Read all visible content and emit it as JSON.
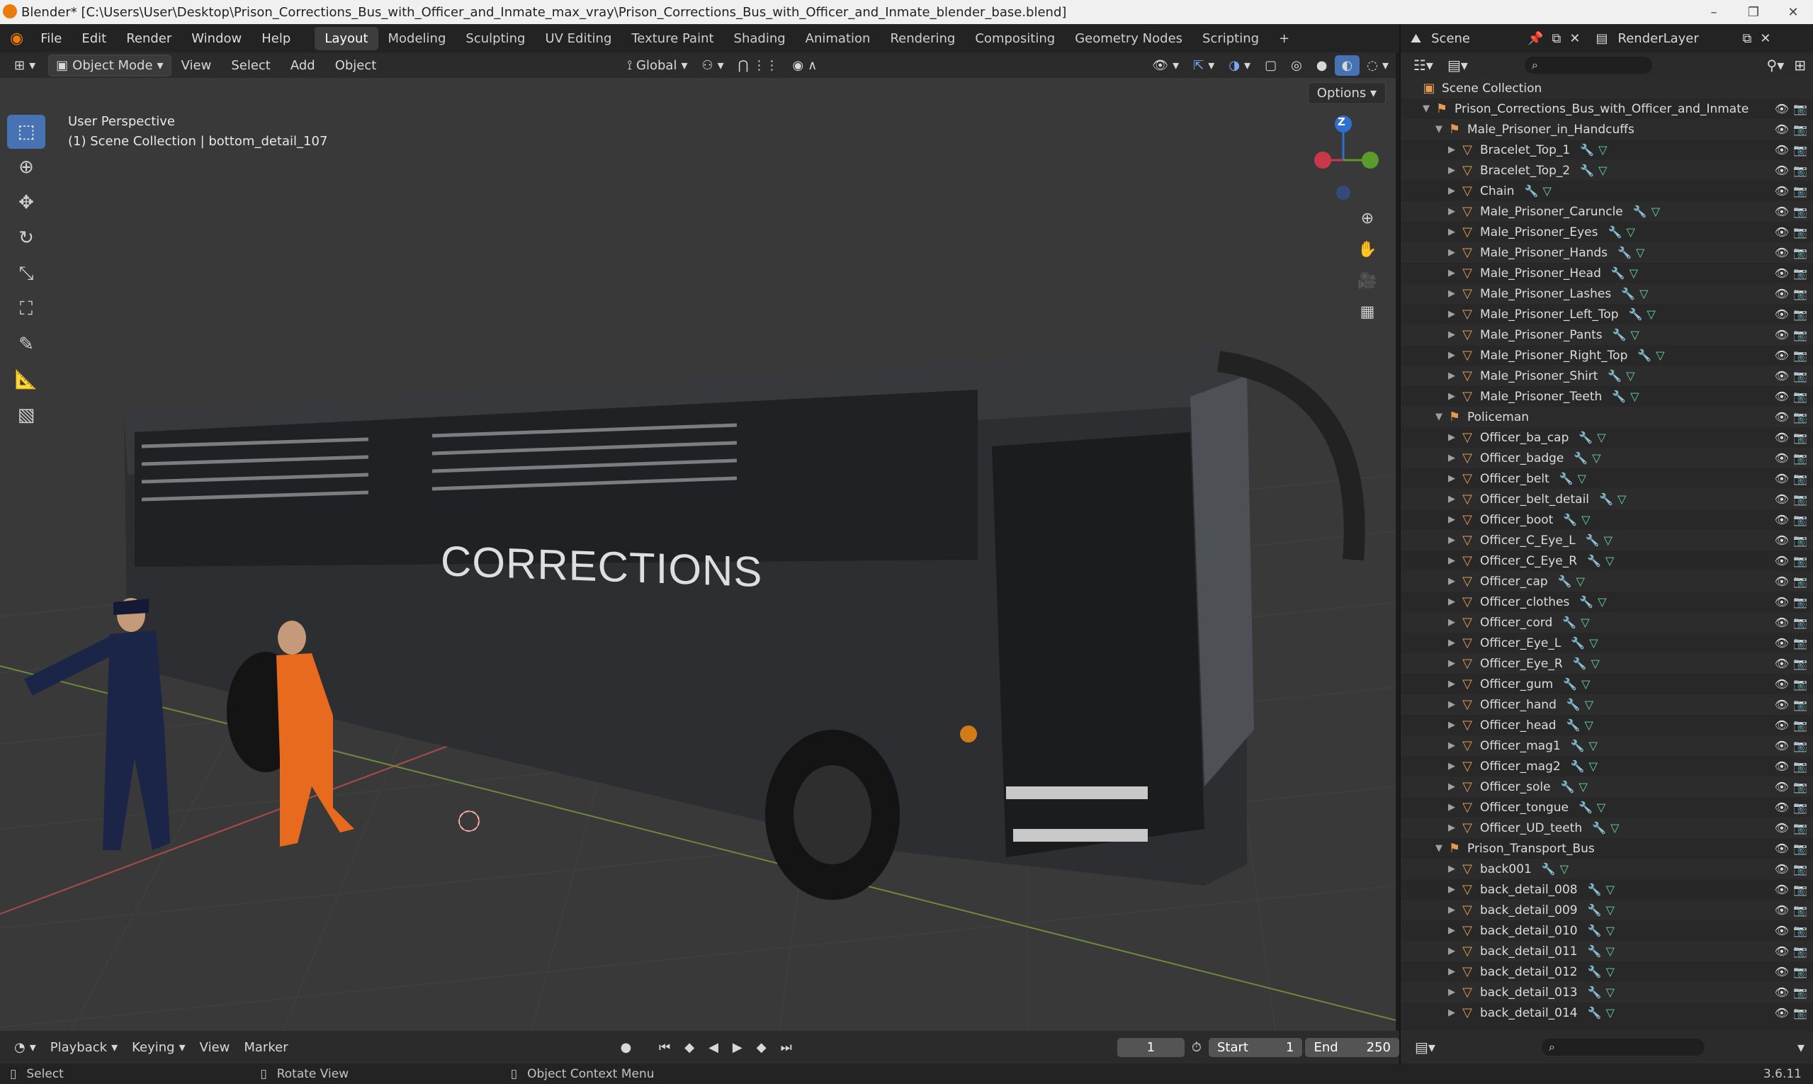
{
  "window": {
    "title": "Blender* [C:\\Users\\User\\Desktop\\Prison_Corrections_Bus_with_Officer_and_Inmate_max_vray\\Prison_Corrections_Bus_with_Officer_and_Inmate_blender_base.blend]",
    "buttons": [
      "–",
      "❐",
      "✕"
    ]
  },
  "menu": [
    "File",
    "Edit",
    "Render",
    "Window",
    "Help"
  ],
  "workspaces": [
    "Layout",
    "Modeling",
    "Sculpting",
    "UV Editing",
    "Texture Paint",
    "Shading",
    "Animation",
    "Rendering",
    "Compositing",
    "Geometry Nodes",
    "Scripting"
  ],
  "active_workspace": "Layout",
  "add_workspace": "+",
  "scene_field": "Scene",
  "render_layer_field": "RenderLayer",
  "viewport_header": {
    "mode": "Object Mode",
    "menus": [
      "View",
      "Select",
      "Add",
      "Object"
    ],
    "orientation": "Global",
    "options": "Options"
  },
  "viewport": {
    "perspective": "User Perspective",
    "collection_info": "(1) Scene Collection | bottom_detail_107",
    "bus_text": "CORRECTIONS",
    "gizmo_axis": "Z"
  },
  "timeline": {
    "menus": [
      "Playback",
      "Keying",
      "View",
      "Marker"
    ],
    "current_frame": "1",
    "start_label": "Start",
    "start": "1",
    "end_label": "End",
    "end": "250"
  },
  "status": {
    "select": "Select",
    "rotate": "Rotate View",
    "context": "Object Context Menu",
    "version": "3.6.11"
  },
  "outliner": [
    {
      "name": "Scene Collection",
      "level": 0,
      "kind": "scene"
    },
    {
      "name": "Prison_Corrections_Bus_with_Officer_and_Inmate",
      "level": 1,
      "kind": "collection"
    },
    {
      "name": "Male_Prisoner_in_Handcuffs",
      "level": 2,
      "kind": "collection"
    },
    {
      "name": "Bracelet_Top_1",
      "level": 3,
      "kind": "object"
    },
    {
      "name": "Bracelet_Top_2",
      "level": 3,
      "kind": "object"
    },
    {
      "name": "Chain",
      "level": 3,
      "kind": "object"
    },
    {
      "name": "Male_Prisoner_Caruncle",
      "level": 3,
      "kind": "object"
    },
    {
      "name": "Male_Prisoner_Eyes",
      "level": 3,
      "kind": "object"
    },
    {
      "name": "Male_Prisoner_Hands",
      "level": 3,
      "kind": "object"
    },
    {
      "name": "Male_Prisoner_Head",
      "level": 3,
      "kind": "object"
    },
    {
      "name": "Male_Prisoner_Lashes",
      "level": 3,
      "kind": "object"
    },
    {
      "name": "Male_Prisoner_Left_Top",
      "level": 3,
      "kind": "object"
    },
    {
      "name": "Male_Prisoner_Pants",
      "level": 3,
      "kind": "object"
    },
    {
      "name": "Male_Prisoner_Right_Top",
      "level": 3,
      "kind": "object"
    },
    {
      "name": "Male_Prisoner_Shirt",
      "level": 3,
      "kind": "object"
    },
    {
      "name": "Male_Prisoner_Teeth",
      "level": 3,
      "kind": "object"
    },
    {
      "name": "Policeman",
      "level": 2,
      "kind": "collection"
    },
    {
      "name": "Officer_ba_cap",
      "level": 3,
      "kind": "object"
    },
    {
      "name": "Officer_badge",
      "level": 3,
      "kind": "object"
    },
    {
      "name": "Officer_belt",
      "level": 3,
      "kind": "object"
    },
    {
      "name": "Officer_belt_detail",
      "level": 3,
      "kind": "object"
    },
    {
      "name": "Officer_boot",
      "level": 3,
      "kind": "object"
    },
    {
      "name": "Officer_C_Eye_L",
      "level": 3,
      "kind": "object"
    },
    {
      "name": "Officer_C_Eye_R",
      "level": 3,
      "kind": "object"
    },
    {
      "name": "Officer_cap",
      "level": 3,
      "kind": "object"
    },
    {
      "name": "Officer_clothes",
      "level": 3,
      "kind": "object"
    },
    {
      "name": "Officer_cord",
      "level": 3,
      "kind": "object"
    },
    {
      "name": "Officer_Eye_L",
      "level": 3,
      "kind": "object"
    },
    {
      "name": "Officer_Eye_R",
      "level": 3,
      "kind": "object"
    },
    {
      "name": "Officer_gum",
      "level": 3,
      "kind": "object"
    },
    {
      "name": "Officer_hand",
      "level": 3,
      "kind": "object"
    },
    {
      "name": "Officer_head",
      "level": 3,
      "kind": "object"
    },
    {
      "name": "Officer_mag1",
      "level": 3,
      "kind": "object"
    },
    {
      "name": "Officer_mag2",
      "level": 3,
      "kind": "object"
    },
    {
      "name": "Officer_sole",
      "level": 3,
      "kind": "object"
    },
    {
      "name": "Officer_tongue",
      "level": 3,
      "kind": "object"
    },
    {
      "name": "Officer_UD_teeth",
      "level": 3,
      "kind": "object"
    },
    {
      "name": "Prison_Transport_Bus",
      "level": 2,
      "kind": "collection"
    },
    {
      "name": "back001",
      "level": 3,
      "kind": "object"
    },
    {
      "name": "back_detail_008",
      "level": 3,
      "kind": "object"
    },
    {
      "name": "back_detail_009",
      "level": 3,
      "kind": "object"
    },
    {
      "name": "back_detail_010",
      "level": 3,
      "kind": "object"
    },
    {
      "name": "back_detail_011",
      "level": 3,
      "kind": "object"
    },
    {
      "name": "back_detail_012",
      "level": 3,
      "kind": "object"
    },
    {
      "name": "back_detail_013",
      "level": 3,
      "kind": "object"
    },
    {
      "name": "back_detail_014",
      "level": 3,
      "kind": "object"
    }
  ]
}
